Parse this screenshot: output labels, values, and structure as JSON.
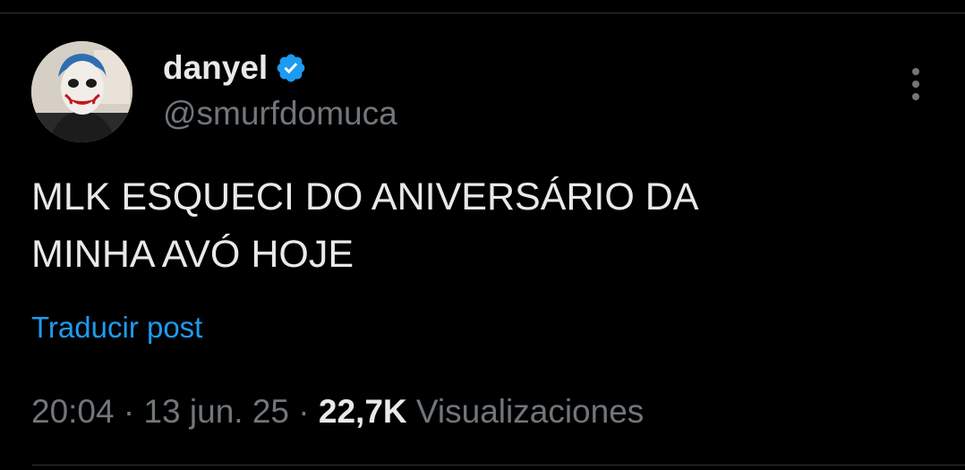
{
  "author": {
    "display_name": "danyel",
    "handle": "@smurfdomuca",
    "verified": true,
    "verified_icon": "verified-badge-icon"
  },
  "post": {
    "text": "MLK ESQUECI DO ANIVERSÁRIO DA\nMINHA AVÓ HOJE",
    "translate_label": "Traducir post"
  },
  "meta": {
    "time": "20:04",
    "separator": "·",
    "date": "13 jun. 25",
    "views_count": "22,7K",
    "views_label": "Visualizaciones"
  },
  "actions": {
    "more_icon": "more-options-icon"
  },
  "colors": {
    "background": "#000000",
    "text_primary": "#e7e9ea",
    "text_secondary": "#71767b",
    "accent": "#1d9bf0",
    "divider": "#2f3336"
  }
}
